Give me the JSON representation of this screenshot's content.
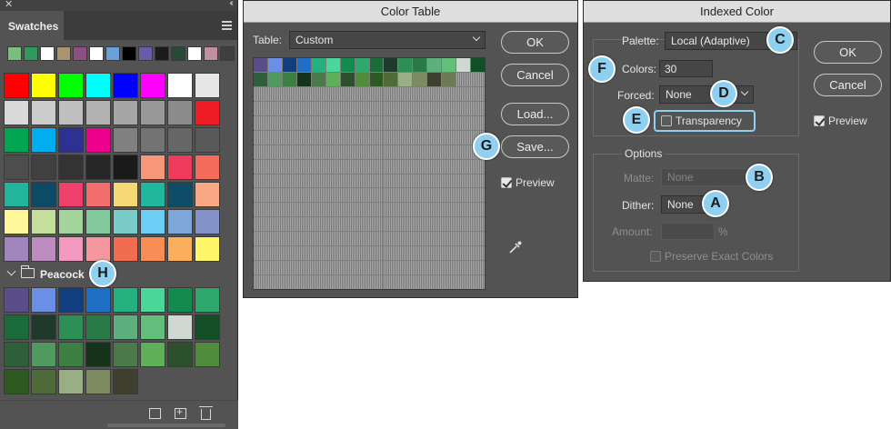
{
  "swatches": {
    "tab_label": "Swatches",
    "recent": [
      "#7bbf7f",
      "#2e9a5e",
      "#ffffff",
      "#a8956f",
      "#8c4f83",
      "#ffffff",
      "#6aa0d8",
      "#000000",
      "#6b5aa8",
      "#1b1b1b",
      "#264a35",
      "#ffffff",
      "#c08fa0",
      "#3f3f3f"
    ],
    "main_grid": [
      "#ff0000",
      "#ffff00",
      "#00ff00",
      "#00ffff",
      "#0000ff",
      "#ff00ff",
      "#ffffff",
      "#e6e6e6",
      "#d9d9d9",
      "#cccccc",
      "#c0c0c0",
      "#b3b3b3",
      "#a6a6a6",
      "#999999",
      "#8c8c8c",
      "#ee1c24",
      "#00a651",
      "#00aeef",
      "#2e3192",
      "#ec008c",
      "#808080",
      "#737373",
      "#666666",
      "#595959",
      "#4d4d4d",
      "#404040",
      "#333333",
      "#262626",
      "#1a1a1a",
      "#f7977a",
      "#ef3b5b",
      "#f46b5b",
      "#22b59b",
      "#0c4a66",
      "#ef3f6b",
      "#f26d6d",
      "#f4d974",
      "#1fb79d",
      "#0e4c68",
      "#f8a882",
      "#fff79a",
      "#c4df9b",
      "#a3d49c",
      "#82ca9c",
      "#7accc8",
      "#6dcff6",
      "#7da7d9",
      "#8393ca",
      "#a186be",
      "#bd8cbf",
      "#f49ac1",
      "#f5989d",
      "#f26c4f",
      "#f68e56",
      "#fbaf5d",
      "#fff568"
    ],
    "group_name": "Peacock",
    "peacock_grid": [
      "#5a4d8a",
      "#6b8fe6",
      "#123e80",
      "#1f6fc4",
      "#23b27f",
      "#4bd69a",
      "#138a4e",
      "#2ea86d",
      "#1c6b3a",
      "#1f3a2a",
      "#2d8f55",
      "#2a7a48",
      "#5faf7e",
      "#62c07c",
      "#d0d8d2",
      "#134f26",
      "#2f5e3b",
      "#519a5f",
      "#3d7f42",
      "#15331b",
      "#4a7a4a",
      "#5fae5a",
      "#2c4f2c",
      "#4f8d3c",
      "#2c5a20",
      "#4f6b3a",
      "#9aae86",
      "#7d8b60",
      "#3f3f30"
    ],
    "callout_h": "H"
  },
  "color_table": {
    "title": "Color Table",
    "table_label": "Table:",
    "table_value": "Custom",
    "colors": [
      "#5a4d8a",
      "#6b8fe6",
      "#123e80",
      "#1f6fc4",
      "#23b27f",
      "#4bd69a",
      "#138a4e",
      "#2ea86d",
      "#1c6b3a",
      "#1f3a2a",
      "#2d8f55",
      "#2a7a48",
      "#5faf7e",
      "#62c07c",
      "#d0d8d2",
      "#134f26",
      "#2f5e3b",
      "#519a5f",
      "#3d7f42",
      "#15331b",
      "#4a7a4a",
      "#5fae5a",
      "#2c4f2c",
      "#4f8d3c",
      "#2c5a20",
      "#4f6b3a",
      "#9aae86",
      "#7d8b60",
      "#3f3f30",
      "#6d7a55"
    ],
    "ok_label": "OK",
    "cancel_label": "Cancel",
    "load_label": "Load...",
    "save_label": "Save...",
    "preview_label": "Preview",
    "preview_checked": true,
    "callout_g": "G"
  },
  "indexed": {
    "title": "Indexed Color",
    "palette_label": "Palette:",
    "palette_value": "Local (Adaptive)",
    "colors_label": "Colors:",
    "colors_value": "30",
    "forced_label": "Forced:",
    "forced_value": "None",
    "transparency_label": "Transparency",
    "options_label": "Options",
    "matte_label": "Matte:",
    "matte_value": "None",
    "dither_label": "Dither:",
    "dither_value": "None",
    "amount_label": "Amount:",
    "amount_unit": "%",
    "preserve_label": "Preserve Exact Colors",
    "ok_label": "OK",
    "cancel_label": "Cancel",
    "preview_label": "Preview",
    "callouts": {
      "a": "A",
      "b": "B",
      "c": "C",
      "d": "D",
      "e": "E",
      "f": "F"
    }
  },
  "colors": {
    "callout": "#8fd0f0",
    "panel_bg": "#535353",
    "titlebar_bg": "#dedede"
  }
}
